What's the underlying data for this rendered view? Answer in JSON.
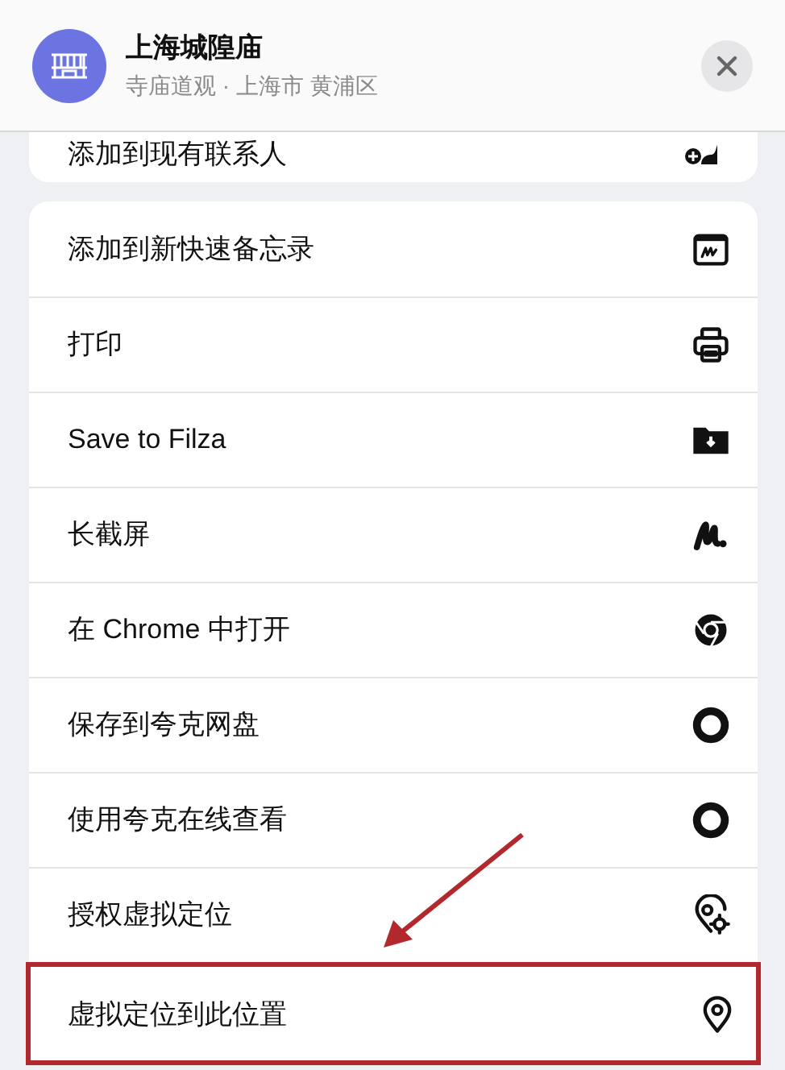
{
  "header": {
    "title": "上海城隍庙",
    "subtitle": "寺庙道观 · 上海市 黄浦区"
  },
  "partial_item": {
    "label": "添加到现有联系人"
  },
  "items": [
    {
      "label": "添加到新快速备忘录",
      "highlighted": false
    },
    {
      "label": "打印",
      "highlighted": false
    },
    {
      "label": "Save to Filza",
      "highlighted": false
    },
    {
      "label": "长截屏",
      "highlighted": false
    },
    {
      "label": "在 Chrome 中打开",
      "highlighted": false
    },
    {
      "label": "保存到夸克网盘",
      "highlighted": false
    },
    {
      "label": "使用夸克在线查看",
      "highlighted": false
    },
    {
      "label": "授权虚拟定位",
      "highlighted": false
    },
    {
      "label": "虚拟定位到此位置",
      "highlighted": true
    }
  ]
}
